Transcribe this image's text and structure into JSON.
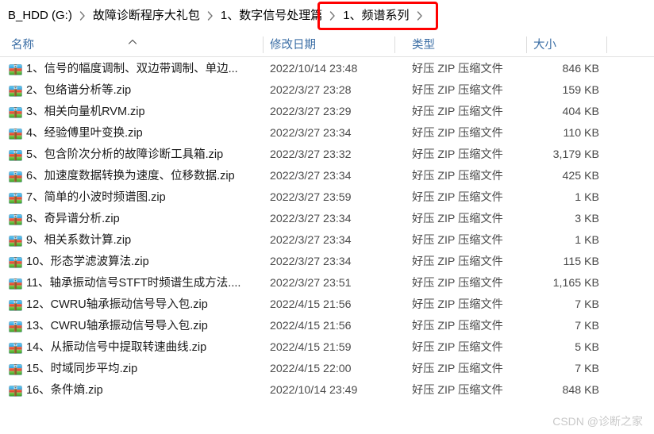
{
  "breadcrumb": {
    "items": [
      {
        "label": "B_HDD (G:)"
      },
      {
        "label": "故障诊断程序大礼包"
      },
      {
        "label": "1、数字信号处理篇"
      },
      {
        "label": "1、频谱系列"
      }
    ],
    "separator": "›",
    "highlight_color": "#ff0000",
    "highlighted_index": 3
  },
  "columns": {
    "name": "名称",
    "date_modified": "修改日期",
    "type": "类型",
    "size": "大小",
    "sort_column": "名称",
    "sort_direction": "ascending"
  },
  "files": [
    {
      "icon": "zip-archive-icon",
      "name": "1、信号的幅度调制、双边带调制、单边...",
      "date": "2022/10/14 23:48",
      "type": "好压 ZIP 压缩文件",
      "size": "846 KB"
    },
    {
      "icon": "zip-archive-icon",
      "name": "2、包络谱分析等.zip",
      "date": "2022/3/27 23:28",
      "type": "好压 ZIP 压缩文件",
      "size": "159 KB"
    },
    {
      "icon": "zip-archive-icon",
      "name": "3、相关向量机RVM.zip",
      "date": "2022/3/27 23:29",
      "type": "好压 ZIP 压缩文件",
      "size": "404 KB"
    },
    {
      "icon": "zip-archive-icon",
      "name": "4、经验傅里叶变换.zip",
      "date": "2022/3/27 23:34",
      "type": "好压 ZIP 压缩文件",
      "size": "110 KB"
    },
    {
      "icon": "zip-archive-icon",
      "name": "5、包含阶次分析的故障诊断工具箱.zip",
      "date": "2022/3/27 23:32",
      "type": "好压 ZIP 压缩文件",
      "size": "3,179 KB"
    },
    {
      "icon": "zip-archive-icon",
      "name": "6、加速度数据转换为速度、位移数据.zip",
      "date": "2022/3/27 23:34",
      "type": "好压 ZIP 压缩文件",
      "size": "425 KB"
    },
    {
      "icon": "zip-archive-icon",
      "name": "7、简单的小波时频谱图.zip",
      "date": "2022/3/27 23:59",
      "type": "好压 ZIP 压缩文件",
      "size": "1 KB"
    },
    {
      "icon": "zip-archive-icon",
      "name": "8、奇异谱分析.zip",
      "date": "2022/3/27 23:34",
      "type": "好压 ZIP 压缩文件",
      "size": "3 KB"
    },
    {
      "icon": "zip-archive-icon",
      "name": "9、相关系数计算.zip",
      "date": "2022/3/27 23:34",
      "type": "好压 ZIP 压缩文件",
      "size": "1 KB"
    },
    {
      "icon": "zip-archive-icon",
      "name": "10、形态学滤波算法.zip",
      "date": "2022/3/27 23:34",
      "type": "好压 ZIP 压缩文件",
      "size": "115 KB"
    },
    {
      "icon": "zip-archive-icon",
      "name": "11、轴承振动信号STFT时频谱生成方法....",
      "date": "2022/3/27 23:51",
      "type": "好压 ZIP 压缩文件",
      "size": "1,165 KB"
    },
    {
      "icon": "zip-archive-icon",
      "name": "12、CWRU轴承振动信号导入包.zip",
      "date": "2022/4/15 21:56",
      "type": "好压 ZIP 压缩文件",
      "size": "7 KB"
    },
    {
      "icon": "zip-archive-icon",
      "name": "13、CWRU轴承振动信号导入包.zip",
      "date": "2022/4/15 21:56",
      "type": "好压 ZIP 压缩文件",
      "size": "7 KB"
    },
    {
      "icon": "zip-archive-icon",
      "name": "14、从振动信号中提取转速曲线.zip",
      "date": "2022/4/15 21:59",
      "type": "好压 ZIP 压缩文件",
      "size": "5 KB"
    },
    {
      "icon": "zip-archive-icon",
      "name": "15、时域同步平均.zip",
      "date": "2022/4/15 22:00",
      "type": "好压 ZIP 压缩文件",
      "size": "7 KB"
    },
    {
      "icon": "zip-archive-icon",
      "name": "16、条件熵.zip",
      "date": "2022/10/14 23:49",
      "type": "好压 ZIP 压缩文件",
      "size": "848 KB"
    }
  ],
  "watermark": {
    "text": "CSDN @诊断之家"
  }
}
